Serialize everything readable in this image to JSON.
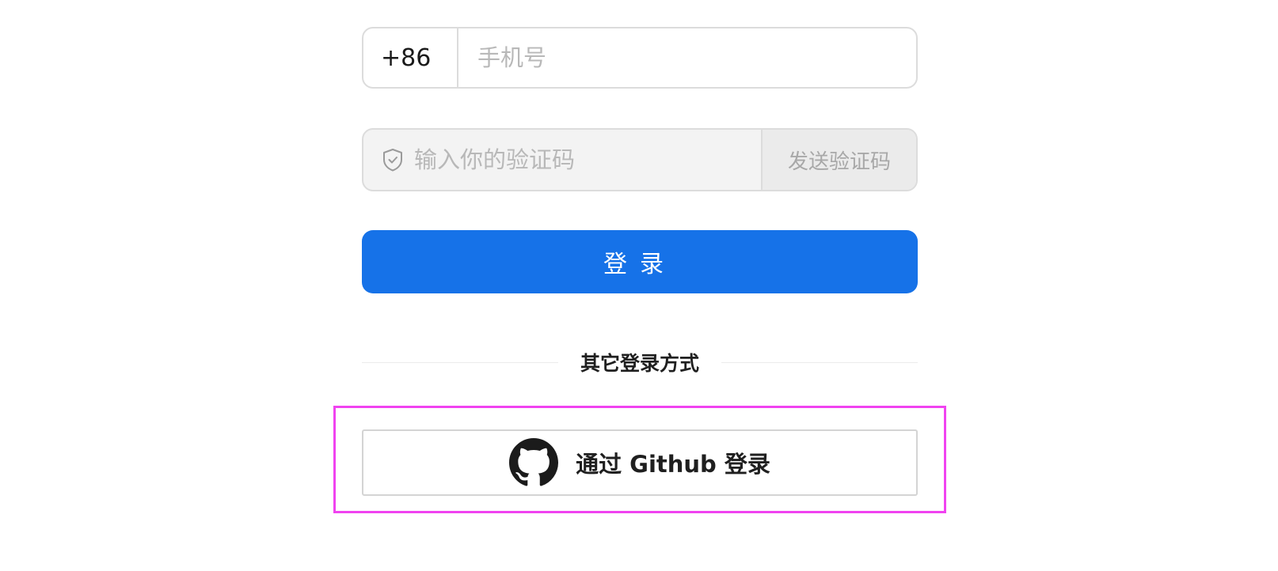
{
  "phone": {
    "country_code": "+86",
    "placeholder": "手机号",
    "value": ""
  },
  "verification": {
    "placeholder": "输入你的验证码",
    "value": "",
    "send_label": "发送验证码",
    "icon": "shield-check-icon"
  },
  "login": {
    "label": "登录"
  },
  "other_login": {
    "divider_text": "其它登录方式",
    "github_label": "通过 Github 登录",
    "github_icon": "github-icon"
  },
  "colors": {
    "primary": "#1672e8",
    "highlight": "#f043f0",
    "border": "#dcdcdc",
    "placeholder": "#b8b8b8"
  }
}
